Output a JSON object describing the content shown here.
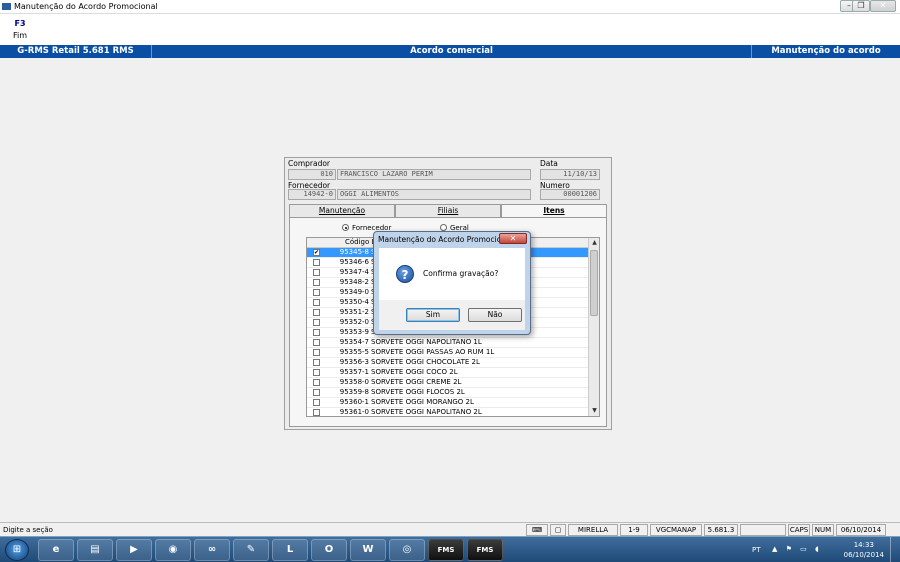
{
  "window": {
    "title": "Manutenção do Acordo Promocional",
    "controls": [
      "minimize",
      "restore",
      "close"
    ]
  },
  "fkeys": [
    {
      "key": "F3",
      "label": "Fim"
    }
  ],
  "header_band": {
    "left": "G-RMS Retail 5.681 RMS",
    "center": "Acordo comercial",
    "right": "Manutenção do acordo"
  },
  "form": {
    "comprador_label": "Comprador",
    "comprador_code": "010",
    "comprador_name": "FRANCISCO LAZARO PERIM",
    "data_label": "Data",
    "data_value": "11/10/13",
    "fornecedor_label": "Fornecedor",
    "fornecedor_code": "14942-0",
    "fornecedor_name": "OGGI ALIMENTOS",
    "numero_label": "Numero",
    "numero_value": "00001206",
    "tabs": [
      {
        "label": "Manutenção",
        "active": false
      },
      {
        "label": "Filiais",
        "active": false
      },
      {
        "label": "Itens",
        "active": true
      }
    ],
    "radio_fornecedor": "Fornecedor",
    "radio_geral": "Geral",
    "grid_header": "Código  D"
  },
  "items": [
    {
      "code": "95345-8",
      "desc": "S",
      "checked": true,
      "selected": true
    },
    {
      "code": "95346-6",
      "desc": "S",
      "checked": false,
      "selected": false
    },
    {
      "code": "95347-4",
      "desc": "S",
      "checked": false,
      "selected": false
    },
    {
      "code": "95348-2",
      "desc": "S",
      "checked": false,
      "selected": false
    },
    {
      "code": "95349-0",
      "desc": "S",
      "checked": false,
      "selected": false
    },
    {
      "code": "95350-4",
      "desc": "S",
      "checked": false,
      "selected": false
    },
    {
      "code": "95351-2",
      "desc": "S",
      "checked": false,
      "selected": false
    },
    {
      "code": "95352-0",
      "desc": "S",
      "checked": false,
      "selected": false
    },
    {
      "code": "95353-9",
      "desc": "S",
      "checked": false,
      "selected": false
    },
    {
      "code": "95354-7",
      "desc": "SORVETE OGGI NAPOLITANO 1L",
      "checked": false,
      "selected": false
    },
    {
      "code": "95355-5",
      "desc": "SORVETE OGGI PASSAS AO RUM 1L",
      "checked": false,
      "selected": false
    },
    {
      "code": "95356-3",
      "desc": "SORVETE OGGI CHOCOLATE 2L",
      "checked": false,
      "selected": false
    },
    {
      "code": "95357-1",
      "desc": "SORVETE OGGI COCO 2L",
      "checked": false,
      "selected": false
    },
    {
      "code": "95358-0",
      "desc": "SORVETE OGGI CREME 2L",
      "checked": false,
      "selected": false
    },
    {
      "code": "95359-8",
      "desc": "SORVETE OGGI FLOCOS 2L",
      "checked": false,
      "selected": false
    },
    {
      "code": "95360-1",
      "desc": "SORVETE OGGI MORANGO 2L",
      "checked": false,
      "selected": false
    },
    {
      "code": "95361-0",
      "desc": "SORVETE OGGI NAPOLITANO 2L",
      "checked": false,
      "selected": false
    }
  ],
  "dialog": {
    "title": "Manutenção do Acordo Promocio...",
    "message": "Confirma gravação?",
    "icon": "question-icon",
    "btn_yes": "Sim",
    "btn_no": "Não"
  },
  "statusbar": {
    "message": "Digite a seção",
    "user": "MIRELLA",
    "range": "1-9",
    "program": "VGCMANAP",
    "version": "5.681.3",
    "caps": "CAPS",
    "num": "NUM",
    "date": "06/10/2014"
  },
  "taskbar": {
    "lang": "PT",
    "time": "14:33",
    "date": "06/10/2014",
    "apps": [
      "ie-icon",
      "explorer-icon",
      "media-player-icon",
      "chrome-icon",
      "app-icon",
      "notes-icon",
      "lync-icon",
      "outlook-icon",
      "word-icon",
      "network-icon",
      "FMS",
      "FMS"
    ]
  },
  "colors": {
    "band": "#0a4fa3",
    "selection": "#3399ff"
  }
}
